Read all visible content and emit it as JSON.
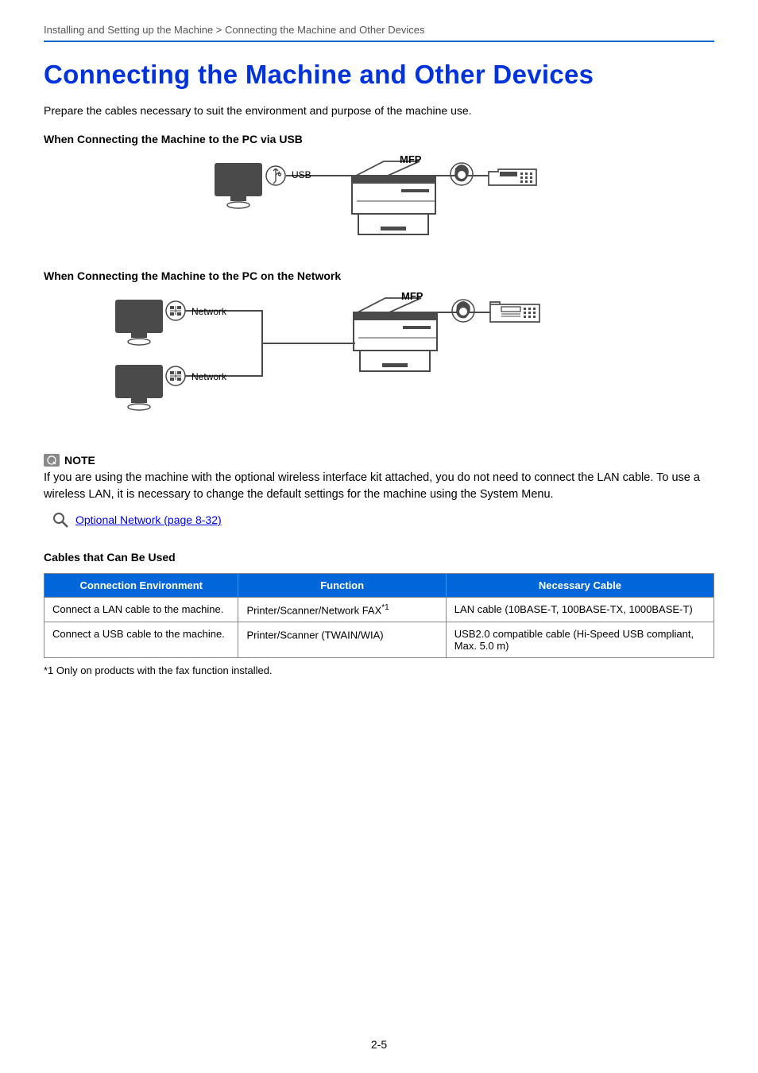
{
  "breadcrumb": "Installing and Setting up the Machine > Connecting the Machine and Other Devices",
  "title": "Connecting the Machine and Other Devices",
  "intro": "Prepare the cables necessary to suit the environment and purpose of the machine use.",
  "sub_usb": "When Connecting the Machine to the PC via USB",
  "sub_network": "When Connecting the Machine to the PC on the Network",
  "labels": {
    "mfp": "MFP",
    "usb": "USB",
    "network": "Network"
  },
  "note": {
    "heading": "NOTE",
    "body": "If you are using the machine with the optional wireless interface kit attached, you do not need to connect the LAN cable. To use a wireless LAN, it is necessary to change the default settings for the machine using the System Menu.",
    "link": "Optional Network (page 8-32)"
  },
  "cables_heading": "Cables that Can Be Used",
  "table": {
    "headers": [
      "Connection Environment",
      "Function",
      "Necessary Cable"
    ],
    "rows": [
      {
        "env": "Connect a LAN cable to the machine.",
        "func": "Printer/Scanner/Network FAX",
        "func_sup": "*1",
        "cable": "LAN cable (10BASE-T, 100BASE-TX, 1000BASE-T)"
      },
      {
        "env": "Connect a USB cable to the machine.",
        "func": "Printer/Scanner (TWAIN/WIA)",
        "func_sup": "",
        "cable": "USB2.0 compatible cable (Hi-Speed USB compliant, Max. 5.0 m)"
      }
    ]
  },
  "footnote": "*1   Only on products with the fax function installed.",
  "page_number": "2-5"
}
